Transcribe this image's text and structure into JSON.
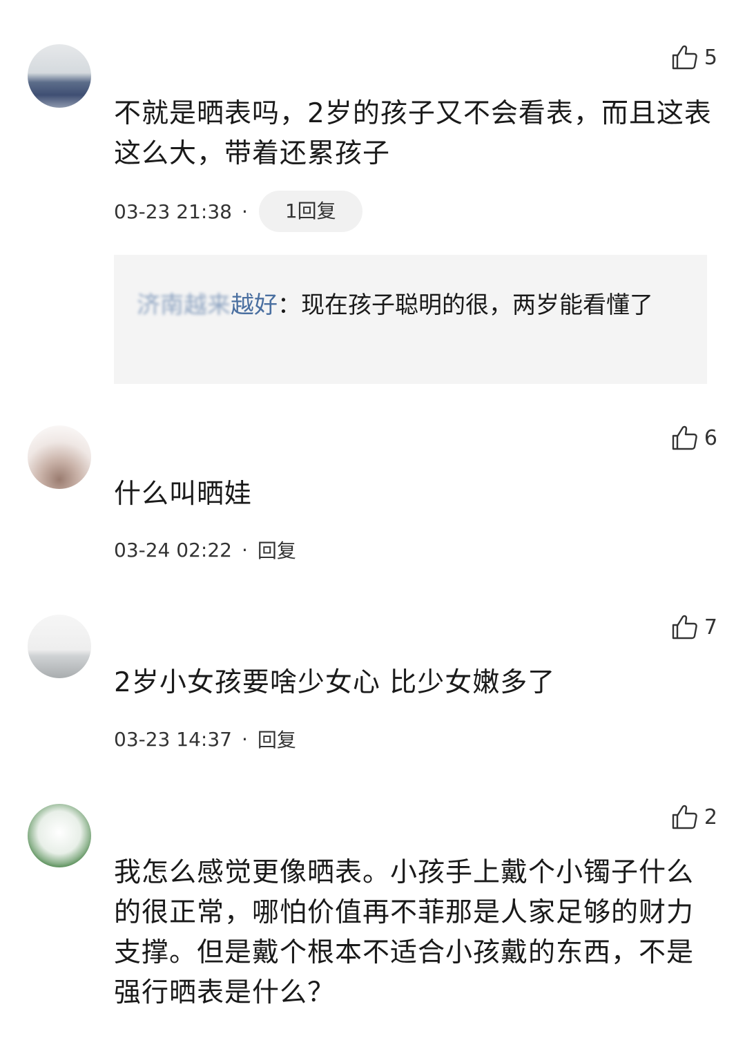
{
  "comments": [
    {
      "username": "",
      "like_count": "5",
      "text": "不就是晒表吗，2岁的孩子又不会看表，而且这表这么大，带着还累孩子",
      "time": "03-23 21:38",
      "reply_label": "1回复",
      "reply": {
        "name_blurred": "济南越来",
        "name_visible": "越好",
        "separator": "：",
        "text": "现在孩子聪明的很，两岁能看懂了"
      }
    },
    {
      "username": "",
      "like_count": "6",
      "text": "什么叫晒娃",
      "time": "03-24 02:22",
      "reply_label": "回复"
    },
    {
      "username": "",
      "like_count": "7",
      "text": "2岁小女孩要啥少女心 比少女嫩多了",
      "time": "03-23 14:37",
      "reply_label": "回复"
    },
    {
      "username": "",
      "like_count": "2",
      "text": "我怎么感觉更像晒表。小孩手上戴个小镯子什么的很正常，哪怕价值再不菲那是人家足够的财力支撑。但是戴个根本不适合小孩戴的东西，不是强行晒表是什么？"
    }
  ],
  "meta_separator": "·",
  "icons": {
    "like": "thumbs-up-icon"
  }
}
